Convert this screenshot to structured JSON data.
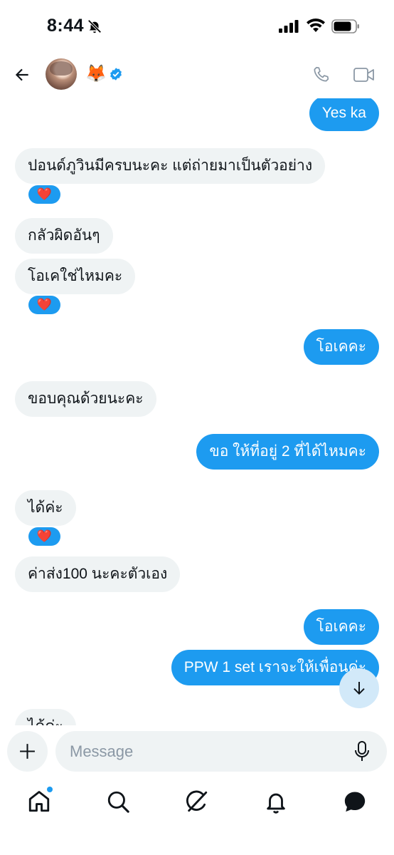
{
  "status_bar": {
    "time": "8:44"
  },
  "header": {
    "emoji": "🦊"
  },
  "messages": [
    {
      "side": "out",
      "text": "Yes ka"
    },
    {
      "side": "in",
      "text": "ปอนด์ภูวินมีครบนะคะ แต่ถ่ายมาเป็นตัวอย่าง",
      "reaction": "❤️"
    },
    {
      "side": "in",
      "text": "กลัวผิดอันๆ"
    },
    {
      "side": "in",
      "text": "โอเคใช่ไหมคะ",
      "reaction": "❤️"
    },
    {
      "side": "out",
      "text": "โอเคคะ"
    },
    {
      "side": "in",
      "text": "ขอบคุณด้วยนะคะ"
    },
    {
      "side": "out",
      "text": "ขอ ให้ที่อยู่ 2 ที่ได้ไหมคะ"
    },
    {
      "side": "in",
      "text": "ได้ค่ะ",
      "reaction": "❤️"
    },
    {
      "side": "in",
      "text": "ค่าส่ง100 นะคะตัวเอง"
    },
    {
      "side": "out",
      "text": "โอเคคะ"
    },
    {
      "side": "out",
      "text": "PPW 1 set เราจะให้เพื่อนค่ะ"
    },
    {
      "side": "in",
      "text": "ได้ค่ะ"
    }
  ],
  "composer": {
    "placeholder": "Message"
  },
  "colors": {
    "accent": "#1d9bf0",
    "incoming_bubble": "#eff3f4",
    "reaction": "#e0245e"
  },
  "icons": {
    "status": [
      "bell-muted-icon",
      "signal-icon",
      "wifi-icon",
      "battery-icon"
    ],
    "header": [
      "back-arrow-icon",
      "verified-badge-icon",
      "phone-icon",
      "video-icon"
    ],
    "nav": [
      "home-icon",
      "search-icon",
      "grok-icon",
      "bell-icon",
      "messages-icon"
    ]
  }
}
